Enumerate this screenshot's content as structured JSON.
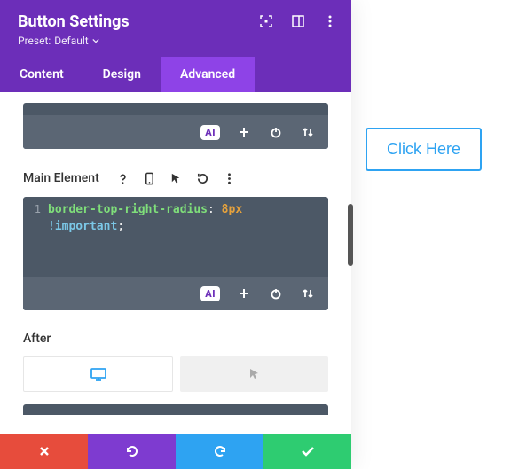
{
  "header": {
    "title": "Button Settings",
    "preset_label": "Preset:",
    "preset_value": "Default"
  },
  "tabs": [
    {
      "label": "Content",
      "active": false
    },
    {
      "label": "Design",
      "active": false
    },
    {
      "label": "Advanced",
      "active": true
    }
  ],
  "sections": {
    "main_element": {
      "label": "Main Element",
      "line_no": "1",
      "code": {
        "property": "border-top-right-radius",
        "colon": ":",
        "value": "8px",
        "important": "!important",
        "semicolon": ";"
      }
    },
    "after": {
      "label": "After"
    }
  },
  "code_toolbar": {
    "ai": "AI"
  },
  "preview": {
    "button_label": "Click Here"
  }
}
